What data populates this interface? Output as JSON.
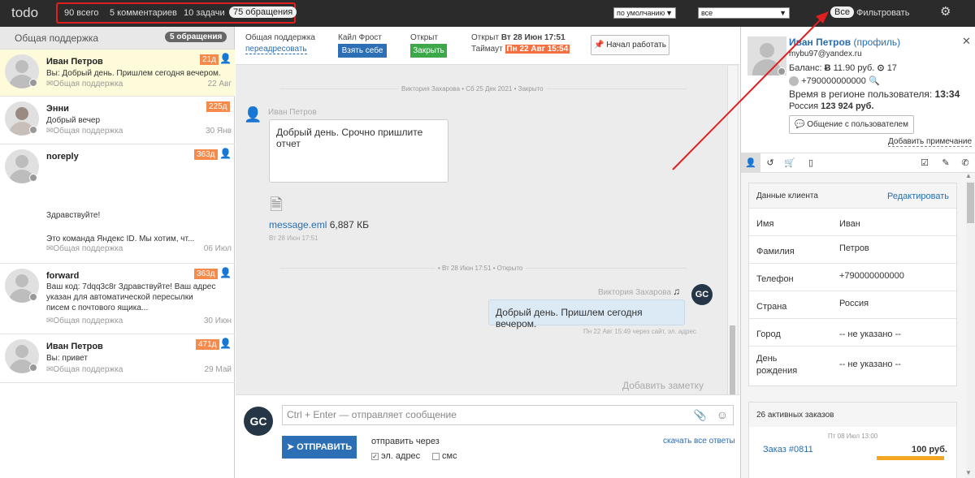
{
  "topbar": {
    "logo": "todo",
    "counts": [
      "90 всего",
      "5 комментариев",
      "10 задачи",
      "75 обращения"
    ],
    "sort": "по умолчанию",
    "filter_scope": "все",
    "all": "Все",
    "filter": "Фильтровать"
  },
  "left": {
    "header": "Общая поддержка",
    "badge": "5 обращения",
    "items": [
      {
        "name": "Иван Петров",
        "text": "Вы: Добрый день. Пришлем сегодня вечером.",
        "queue": "Общая поддержка",
        "date": "22 Авг",
        "age": "21д"
      },
      {
        "name": "Энни",
        "text": "Добрый вечер",
        "queue": "Общая поддержка",
        "date": "30 Янв",
        "age": "225д"
      },
      {
        "name": "noreply",
        "text": "Здравствуйте!",
        "text2": "Это команда Яндекс ID. Мы хотим, чт...",
        "queue": "Общая поддержка",
        "date": "06 Июл",
        "age": "363д"
      },
      {
        "name": "forward",
        "text": "Ваш код: 7dqq3c8r Здравствуйте! Ваш адрес указан для автоматической пересылки писем с почтового ящика...",
        "queue": "Общая поддержка",
        "date": "30 Июн",
        "age": "363д"
      },
      {
        "name": "Иван Петров",
        "text": "Вы: привет",
        "queue": "Общая поддержка",
        "date": "29 Май",
        "age": "471д"
      }
    ]
  },
  "ticket": {
    "queue": "Общая поддержка",
    "reassign": "переадресовать",
    "assignee": "Кайл Фрост",
    "take": "Взять себе",
    "status": "Открыт",
    "close": "Закрыть",
    "opened_label": "Открыт",
    "opened": "Вт 28 Июн 17:51",
    "timeout_label": "Таймаут",
    "timeout": "Пн 22 Авг 15:54",
    "start": "Начал работать"
  },
  "chat": {
    "sep1": "Виктория Захарова • Сб 25 Дек 2021 • Закрыто",
    "author1": "Иван Петров",
    "msg1": "Добрый день. Срочно пришлите отчет",
    "file": "message.eml",
    "filesize": "6,887 КБ",
    "file_time": "Вт 28 Июн 17:51",
    "sep2": "• Вт 28 Июн 17:51 • Открыто",
    "author2": "Виктория Захарова",
    "msg2": "Добрый день. Пришлем сегодня вечером.",
    "msg2_meta": "Пн 22 Авг 15:49 через сайт, эл. адрес",
    "add_note": "Добавить заметку"
  },
  "compose": {
    "placeholder": "Ctrl + Enter — отправляет сообщение",
    "send": "ОТПРАВИТЬ",
    "via": "отправить через",
    "email": "эл. адрес",
    "sms": "смс",
    "download": "скачать все ответы",
    "avatar": "GC"
  },
  "profile": {
    "name": "Иван Петров",
    "profile_link": "(профиль)",
    "email": "mybu97@yandex.ru",
    "balance_label": "Баланс:",
    "balance": "11.90 руб.",
    "points": "17",
    "phone": "+790000000000",
    "time_label": "Время в регионе пользователя:",
    "time": "13:34",
    "country": "Россия",
    "amount": "123 924 руб.",
    "chat_btn": "Общение с пользователем",
    "add_note": "Добавить примечание"
  },
  "client": {
    "title": "Данные клиента",
    "edit": "Редактировать",
    "rows": [
      {
        "label": "Имя",
        "value": "Иван"
      },
      {
        "label": "Фамилия",
        "value": "Петров"
      },
      {
        "label": "Телефон",
        "value": "+790000000000"
      },
      {
        "label": "Страна",
        "value": "Россия"
      },
      {
        "label": "Город",
        "value": "-- не указано --"
      },
      {
        "label": "День рождения",
        "value": "-- не указано --"
      }
    ]
  },
  "orders": {
    "title": "26 активных заказов",
    "date": "Пт 08 Июл 13:00",
    "order": "Заказ #0811",
    "price": "100 руб."
  },
  "colors": {
    "accent": "#2d6fb4",
    "highlight": "#e02020",
    "age": "#f58a4b",
    "green": "#3ca84a"
  }
}
